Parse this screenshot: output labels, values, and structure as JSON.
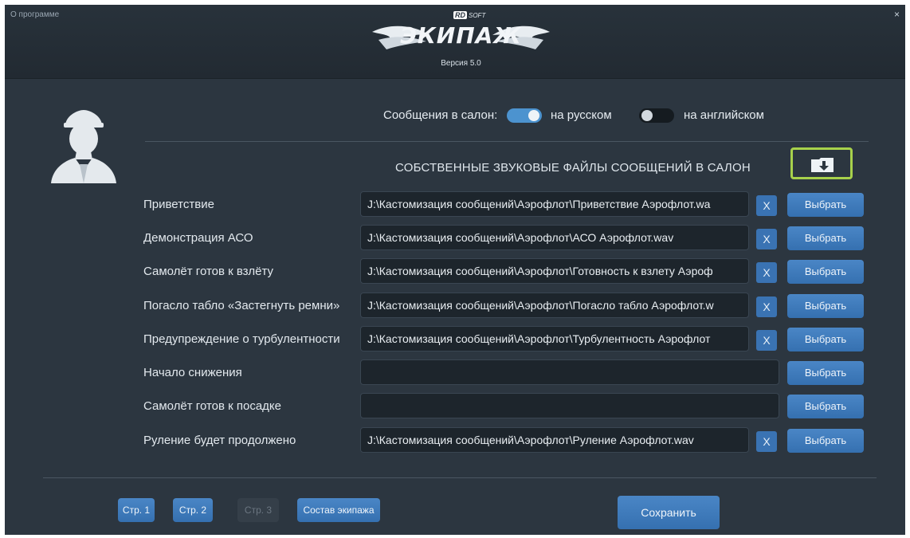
{
  "window": {
    "about_label": "О программе",
    "close_label": "×"
  },
  "logo": {
    "brand_rd": "RD",
    "brand_soft": "SOFT",
    "brand_name": "ЭКИПАЖ",
    "version": "Версия 5.0"
  },
  "messages": {
    "label": "Сообщения в салон:",
    "russian_label": "на русском",
    "russian_on": true,
    "english_label": "на английском",
    "english_on": false
  },
  "section_title": "СОБСТВЕННЫЕ ЗВУКОВЫЕ ФАЙЛЫ СООБЩЕНИЙ В САЛОН",
  "rows": [
    {
      "label": "Приветствие",
      "path": "J:\\Кастомизация сообщений\\Аэрофлот\\Приветствие Аэрофлот.wa",
      "clear": "X",
      "choose": "Выбрать"
    },
    {
      "label": "Демонстрация АСО",
      "path": "J:\\Кастомизация сообщений\\Аэрофлот\\АСО Аэрофлот.wav",
      "clear": "X",
      "choose": "Выбрать"
    },
    {
      "label": "Самолёт готов к взлёту",
      "path": "J:\\Кастомизация сообщений\\Аэрофлот\\Готовность к взлету Аэроф",
      "clear": "X",
      "choose": "Выбрать"
    },
    {
      "label": "Погасло табло «Застегнуть ремни»",
      "path": "J:\\Кастомизация сообщений\\Аэрофлот\\Погасло табло Аэрофлот.w",
      "clear": "X",
      "choose": "Выбрать"
    },
    {
      "label": "Предупреждение о турбулентности",
      "path": "J:\\Кастомизация сообщений\\Аэрофлот\\Турбулентность Аэрофлот",
      "clear": "X",
      "choose": "Выбрать"
    },
    {
      "label": "Начало снижения",
      "path": "",
      "clear": "",
      "choose": "Выбрать"
    },
    {
      "label": "Самолёт готов к посадке",
      "path": "",
      "clear": "",
      "choose": "Выбрать"
    },
    {
      "label": "Руление будет продолжено",
      "path": "J:\\Кастомизация сообщений\\Аэрофлот\\Руление Аэрофлот.wav",
      "clear": "X",
      "choose": "Выбрать"
    }
  ],
  "footer": {
    "page1": "Стр. 1",
    "page2": "Стр. 2",
    "page3": "Стр. 3",
    "crew": "Состав экипажа",
    "save": "Сохранить"
  },
  "colors": {
    "accent": "#3f7cc0",
    "highlight": "#a7d14b",
    "background": "#2c3640"
  }
}
